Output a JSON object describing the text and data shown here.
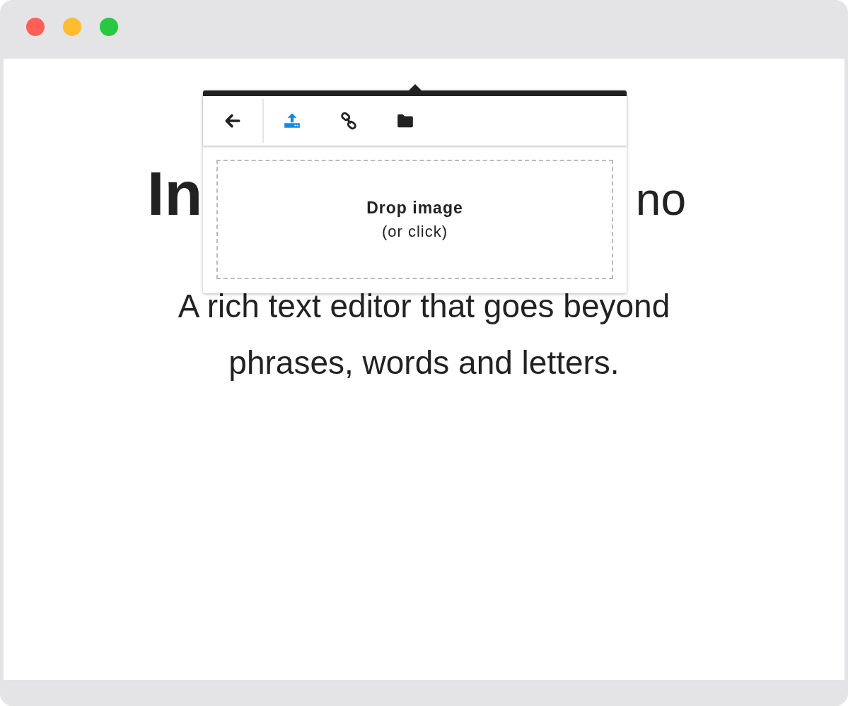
{
  "heading": {
    "start": "In",
    "end": "no"
  },
  "subtitle": "A rich text editor that goes beyond phrases, words and letters.",
  "image_popup": {
    "tools": [
      {
        "kind": "back",
        "selected": false
      },
      {
        "kind": "upload",
        "selected": true
      },
      {
        "kind": "link",
        "selected": false
      },
      {
        "kind": "folder",
        "selected": false
      }
    ],
    "drop_zone": {
      "title": "Drop image",
      "hint": "(or click)"
    }
  }
}
